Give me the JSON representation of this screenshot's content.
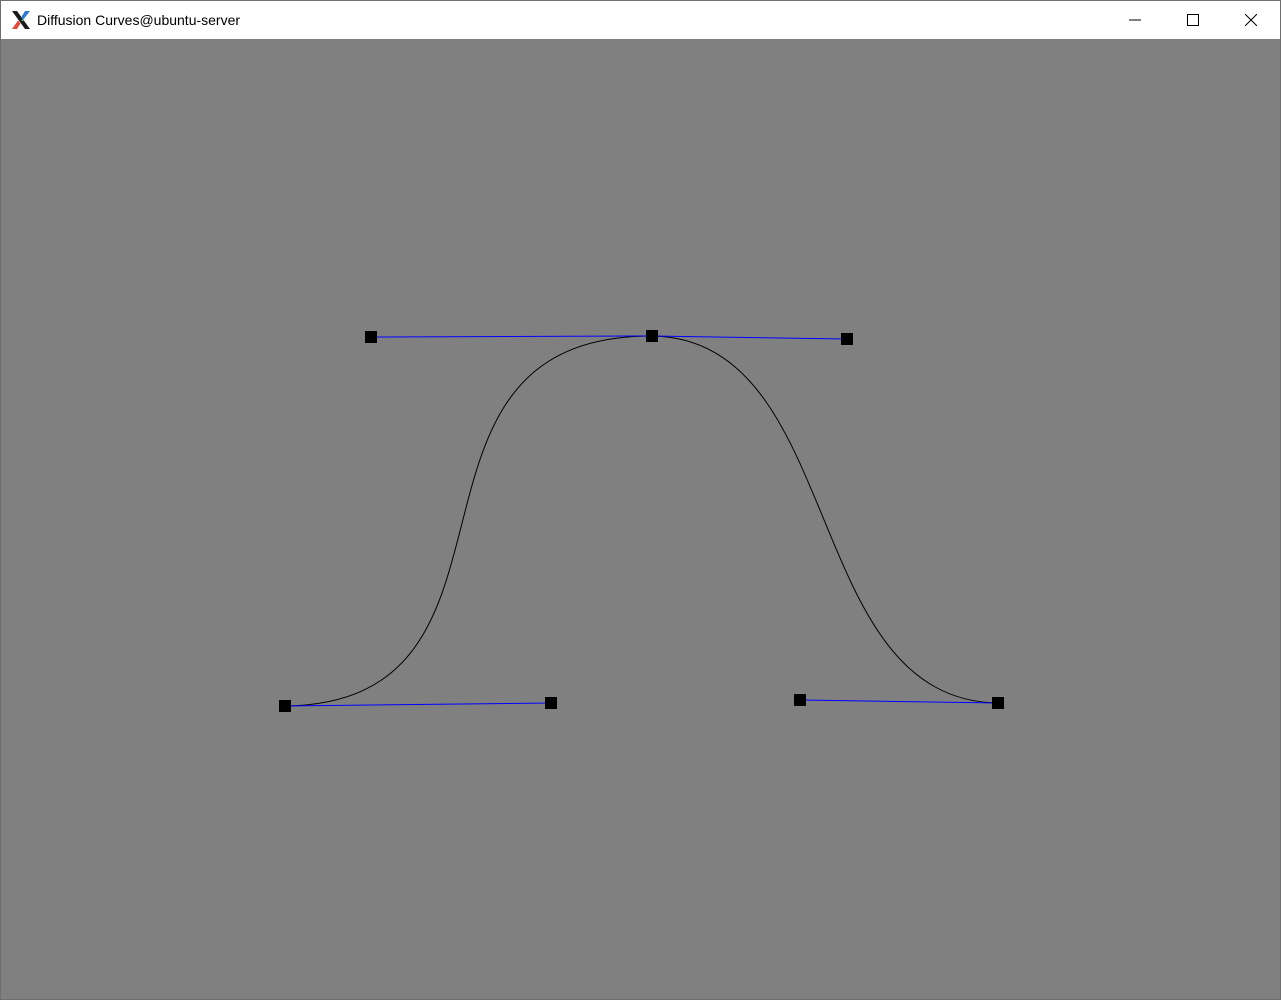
{
  "window": {
    "title": "Diffusion Curves@ubuntu-server",
    "app_icon": "x-window-system-icon",
    "controls": [
      "minimize-icon",
      "maximize-icon",
      "close-icon"
    ]
  },
  "canvas": {
    "background_color": "#808080",
    "curve_color": "#000000",
    "handle_line_color": "#0000ff",
    "control_point_color": "#000000"
  }
}
